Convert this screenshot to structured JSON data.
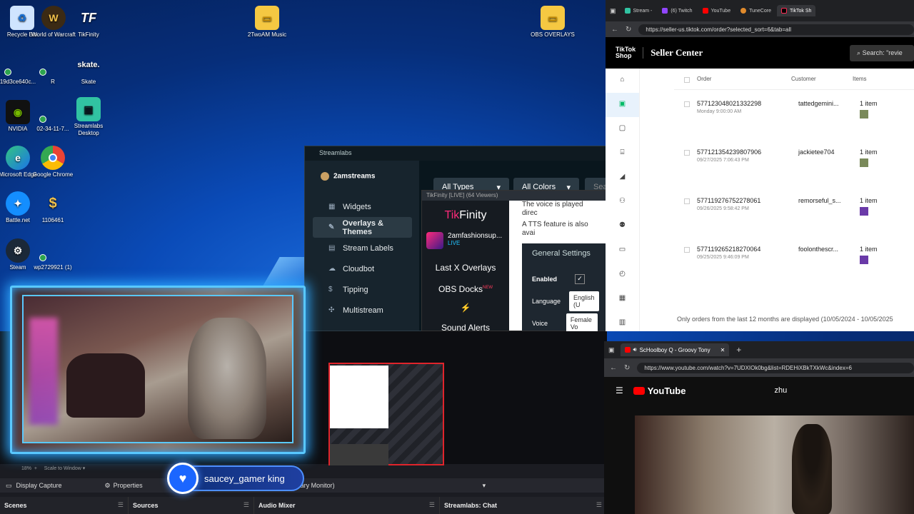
{
  "desktop": {
    "icons": [
      {
        "label": "Recycle Bin"
      },
      {
        "label": "World of Warcraft"
      },
      {
        "label": "TikFinity"
      },
      {
        "label": "19d3ce640c..."
      },
      {
        "label": "R"
      },
      {
        "label": "Skate"
      },
      {
        "label": "NVIDIA"
      },
      {
        "label": "02-34-11-7..."
      },
      {
        "label": "Streamlabs Desktop"
      },
      {
        "label": "Microsoft Edge"
      },
      {
        "label": "Google Chrome"
      },
      {
        "label": "Battle.net"
      },
      {
        "label": "1106461"
      },
      {
        "label": "Steam"
      },
      {
        "label": "wp2729921 (1)"
      },
      {
        "label": "2TwoAM Music"
      },
      {
        "label": "OBS OVERLAYS"
      }
    ]
  },
  "streamlabs": {
    "title": "Streamlabs",
    "user": "2amstreams",
    "nav": [
      "Widgets",
      "Overlays & Themes",
      "Stream Labels",
      "Cloudbot",
      "Tipping",
      "Multistream"
    ],
    "filters": {
      "type": "All Types",
      "colors": "All Colors",
      "search": "Sea"
    }
  },
  "tikfinity": {
    "window_title": "TikFinity [LIVE] (64 Viewers)",
    "logo_a": "Tik",
    "logo_b": "Finity",
    "user": "2amfashionsup...",
    "live": "LIVE",
    "nav": [
      "Last X Overlays",
      "OBS Docks",
      "Sound Alerts"
    ],
    "new_badge": "NEW",
    "text_line1": "The voice is played direc",
    "text_line2": "A TTS feature is also avai",
    "settings": {
      "title": "General Settings",
      "enabled_label": "Enabled",
      "language_label": "Language",
      "language_value": "English (U",
      "voice_label": "Voice",
      "voice_value": "Female Vo"
    }
  },
  "obs": {
    "scale": "18%",
    "scale_label": "Scale to Window",
    "source": "Display Capture",
    "properties": "Properties",
    "monitor": "0 (Primary Monitor)",
    "docks": [
      "Scenes",
      "Sources",
      "Audio Mixer",
      "Streamlabs: Chat"
    ]
  },
  "alert": {
    "text": "saucey_gamer king"
  },
  "tiktok_browser": {
    "tabs": [
      "Stream - ",
      "(6) Twitch",
      "YouTube",
      "TuneCore",
      "TikTok Sh"
    ],
    "url": "https://seller-us.tiktok.com/order?selected_sort=6&tab=all",
    "logo_top": "TikTok",
    "logo_bottom": "Shop",
    "title": "Seller Center",
    "search": "Search: \"revie",
    "columns": [
      "Order",
      "Customer",
      "Items"
    ],
    "orders": [
      {
        "id": "577123048021332298",
        "date": "Monday 9:00:00 AM",
        "customer": "tattedgemini...",
        "items": "1 item"
      },
      {
        "id": "577121354239807906",
        "date": "09/27/2025 7:06:43 PM",
        "customer": "jackietee704",
        "items": "1 item"
      },
      {
        "id": "577119276752278061",
        "date": "09/26/2025 9:58:42 PM",
        "customer": "remorseful_s...",
        "items": "1 item"
      },
      {
        "id": "577119265218270064",
        "date": "09/25/2025 9:46:09 PM",
        "customer": "foolonthescr...",
        "items": "1 item"
      }
    ],
    "footer": "Only orders from the last 12 months are displayed (10/05/2024 - 10/05/2025"
  },
  "youtube_browser": {
    "tab": "ScHoolboy Q - Groovy Tony",
    "url": "https://www.youtube.com/watch?v=7UDXIOk0bg&list=RDEHiXBkTXkWc&index=6",
    "logo": "YouTube",
    "query": "zhu"
  },
  "colors": {
    "accent": "#59c8ff",
    "tiktok_red": "#fe2c55",
    "streamlabs_bg": "#17242d"
  }
}
